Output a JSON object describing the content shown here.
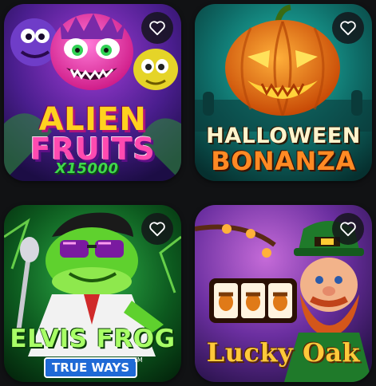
{
  "games": [
    {
      "title_line1": "ALIEN",
      "title_line2": "FRUITS",
      "subtitle": "X15000",
      "favorite_icon": "heart-outline-icon",
      "colors": {
        "bg": "#3b1a7a",
        "title_top": "#ffd21f",
        "title_bottom": "#ff3aa1",
        "subtitle": "#3fd94a"
      }
    },
    {
      "title_line1": "HALLOWEEN",
      "title_line2": "BONANZA",
      "favorite_icon": "heart-outline-icon",
      "colors": {
        "bg": "#0f6f6a",
        "pumpkin": "#f07a12",
        "title": "#ffe79a",
        "title_bottom": "#ff7a1a"
      }
    },
    {
      "title_line1": "ELVIS FROG",
      "badge": "TRUE WAYS",
      "badge_mark": "TM",
      "favorite_icon": "heart-outline-icon",
      "colors": {
        "bg": "#0d5a1f",
        "frog": "#5fd12e",
        "title": "#9aff5a",
        "badge_bg": "#1f6ad6"
      }
    },
    {
      "title_line1": "Lucky Oak",
      "favorite_icon": "heart-outline-icon",
      "colors": {
        "bg": "#6b2fa0",
        "title": "#ffc93a",
        "hat": "#1f7a2a",
        "beard": "#d4561a"
      }
    }
  ]
}
